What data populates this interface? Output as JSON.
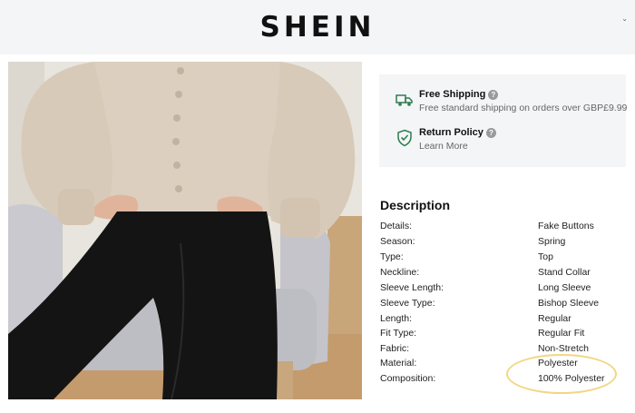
{
  "header": {
    "logo": "SHEIN",
    "caret": "⌄"
  },
  "product_image": {
    "alt": "Model wearing beige satin button-front blouse with bishop sleeves and black jeans, seated on a grey chair"
  },
  "shipping": {
    "free_shipping": {
      "title": "Free Shipping",
      "subtitle": "Free standard shipping on orders over GBP£9.99",
      "icon": "truck-icon"
    },
    "return_policy": {
      "title": "Return Policy",
      "subtitle": "Learn More",
      "icon": "shield-check-icon"
    }
  },
  "description": {
    "title": "Description",
    "rows": [
      {
        "label": "Details:",
        "value": "Fake Buttons"
      },
      {
        "label": "Season:",
        "value": "Spring"
      },
      {
        "label": "Type:",
        "value": "Top"
      },
      {
        "label": "Neckline:",
        "value": "Stand Collar"
      },
      {
        "label": "Sleeve Length:",
        "value": "Long Sleeve"
      },
      {
        "label": "Sleeve Type:",
        "value": "Bishop Sleeve"
      },
      {
        "label": "Length:",
        "value": "Regular"
      },
      {
        "label": "Fit Type:",
        "value": "Regular Fit"
      },
      {
        "label": "Fabric:",
        "value": "Non-Stretch"
      },
      {
        "label": "Material:",
        "value": "Polyester"
      },
      {
        "label": "Composition:",
        "value": "100% Polyester"
      }
    ]
  },
  "colors": {
    "accent_green": "#2e7d4f",
    "highlight": "#f1d782"
  }
}
